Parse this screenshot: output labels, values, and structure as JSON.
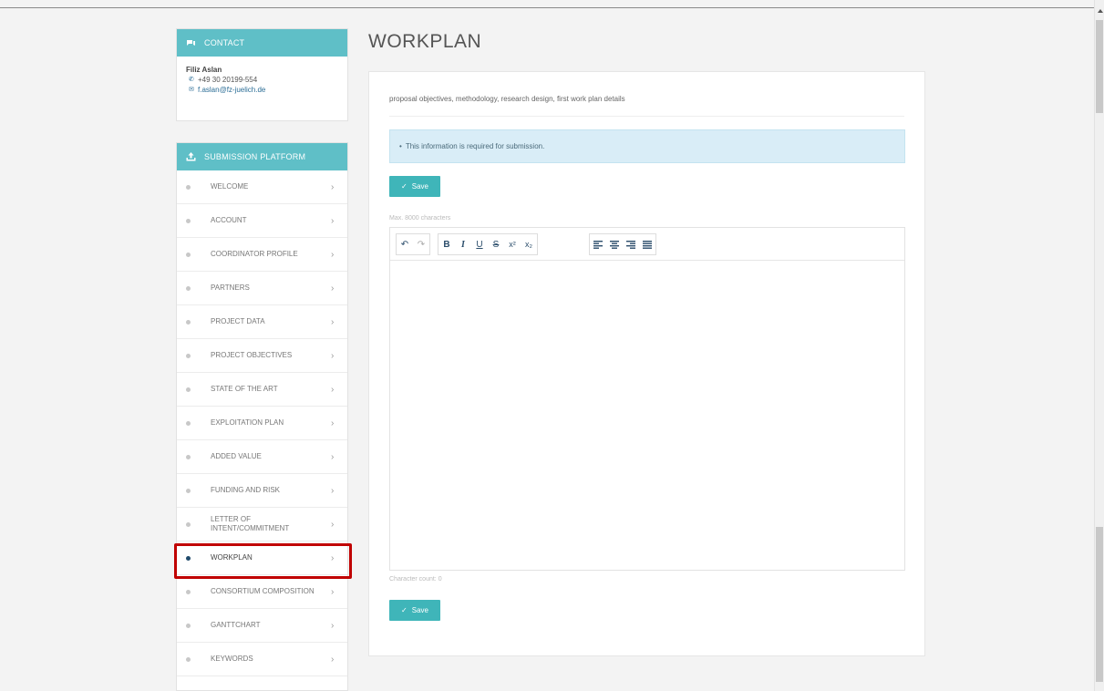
{
  "page": {
    "title": "WORKPLAN"
  },
  "contact": {
    "heading": "CONTACT",
    "name": "Filiz Aslan",
    "phone": "+49 30 20199-554",
    "email": "f.aslan@fz-juelich.de"
  },
  "platform": {
    "heading": "SUBMISSION PLATFORM",
    "items": [
      {
        "label": "WELCOME",
        "active": false
      },
      {
        "label": "ACCOUNT",
        "active": false
      },
      {
        "label": "COORDINATOR PROFILE",
        "active": false
      },
      {
        "label": "PARTNERS",
        "active": false
      },
      {
        "label": "PROJECT DATA",
        "active": false
      },
      {
        "label": "PROJECT OBJECTIVES",
        "active": false
      },
      {
        "label": "STATE OF THE ART",
        "active": false
      },
      {
        "label": "EXPLOITATION PLAN",
        "active": false
      },
      {
        "label": "ADDED VALUE",
        "active": false
      },
      {
        "label": "FUNDING AND RISK",
        "active": false
      },
      {
        "label": "LETTER OF INTENT/COMMITMENT",
        "active": false
      },
      {
        "label": "WORKPLAN",
        "active": true
      },
      {
        "label": "CONSORTIUM COMPOSITION",
        "active": false
      },
      {
        "label": "GANTTCHART",
        "active": false
      },
      {
        "label": "KEYWORDS",
        "active": false
      }
    ]
  },
  "main": {
    "description": "proposal objectives, methodology, research design, first work plan details",
    "alert": "This information is required for submission.",
    "save_label": "Save",
    "max_chars": "Max. 8000 characters",
    "char_count": "Character count: 0"
  },
  "colors": {
    "accent": "#5fbfc7",
    "button": "#3fb5b9",
    "alert_bg": "#d9edf7",
    "highlight": "#c00000",
    "active_dot": "#1f4a6b"
  }
}
